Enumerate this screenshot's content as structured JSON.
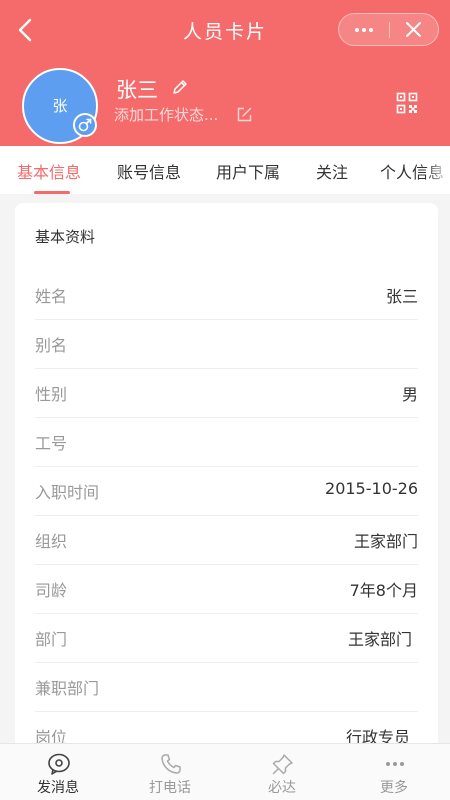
{
  "header": {
    "title": "人员卡片",
    "more_icon": "more-dots-icon",
    "close_icon": "close-icon",
    "background": "#f56b6b"
  },
  "profile": {
    "avatar_text": "张",
    "avatar_color": "#5d9ef0",
    "gender_icon": "male-icon",
    "name": "张三",
    "status_placeholder": "添加工作状态...",
    "qr_icon": "qrcode-icon"
  },
  "tabs": [
    {
      "label": "基本信息",
      "active": true
    },
    {
      "label": "账号信息",
      "active": false
    },
    {
      "label": "用户下属",
      "active": false
    },
    {
      "label": "关注",
      "active": false
    },
    {
      "label": "个人信息",
      "active": false
    }
  ],
  "basic_info": {
    "section_title": "基本资料",
    "rows": [
      {
        "label": "姓名",
        "value": "张三"
      },
      {
        "label": "别名",
        "value": ""
      },
      {
        "label": "性别",
        "value": "男"
      },
      {
        "label": "工号",
        "value": ""
      },
      {
        "label": "入职时间",
        "value": "2015-10-26"
      },
      {
        "label": "组织",
        "value": "王家部门"
      },
      {
        "label": "司龄",
        "value": "7年8个月"
      },
      {
        "label": "部门",
        "value": "王家部门"
      },
      {
        "label": "兼职部门",
        "value": ""
      },
      {
        "label": "岗位",
        "value": "行政专员"
      }
    ]
  },
  "actions": [
    {
      "label": "发消息",
      "icon": "message-icon"
    },
    {
      "label": "打电话",
      "icon": "phone-icon"
    },
    {
      "label": "必达",
      "icon": "pin-icon"
    },
    {
      "label": "更多",
      "icon": "more-dots-icon"
    }
  ]
}
